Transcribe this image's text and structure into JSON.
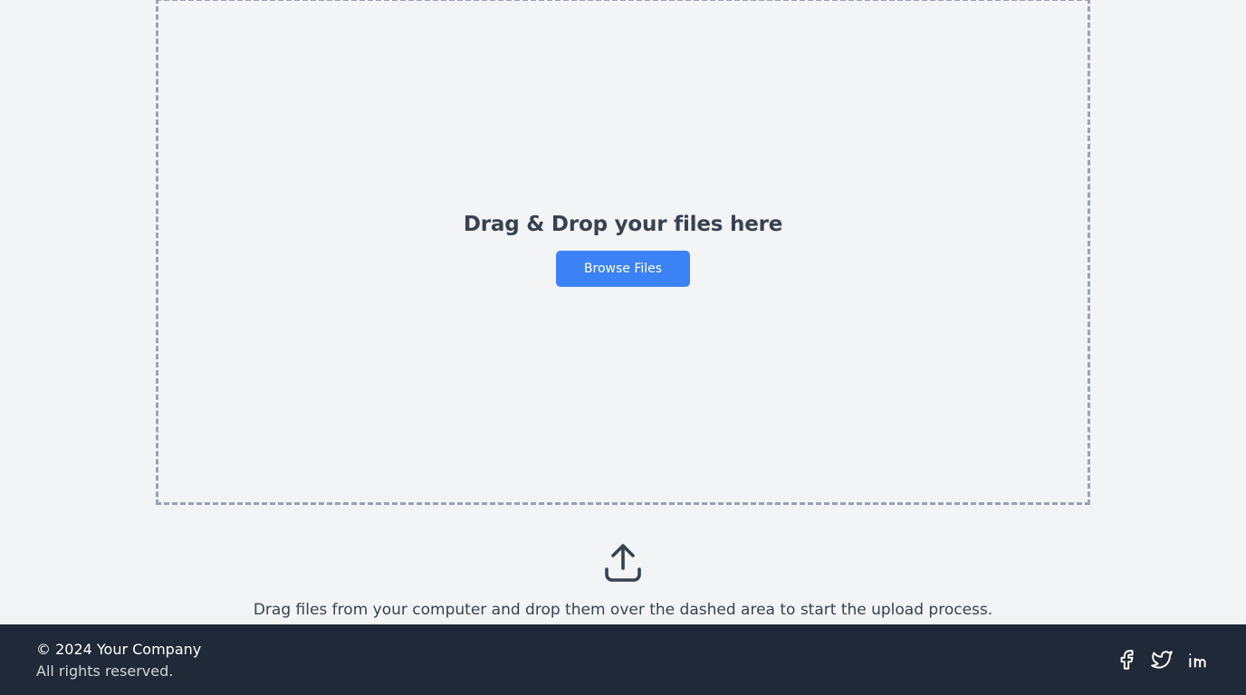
{
  "dropzone": {
    "title": "Drag & Drop your files here",
    "browse_label": "Browse Files"
  },
  "upload": {
    "icon": "upload-icon",
    "instructions": "Drag files from your computer and drop them over the dashed area to start the upload process."
  },
  "footer": {
    "copyright": "© 2024 Your Company",
    "rights": "All rights reserved.",
    "social": [
      "facebook-icon",
      "twitter-icon",
      "linkedin-icon"
    ]
  },
  "colors": {
    "background": "#f3f4f6",
    "accent": "#3b82f6",
    "footer": "#1f2937",
    "dashed_border": "#9ca3af",
    "text": "#374151"
  }
}
